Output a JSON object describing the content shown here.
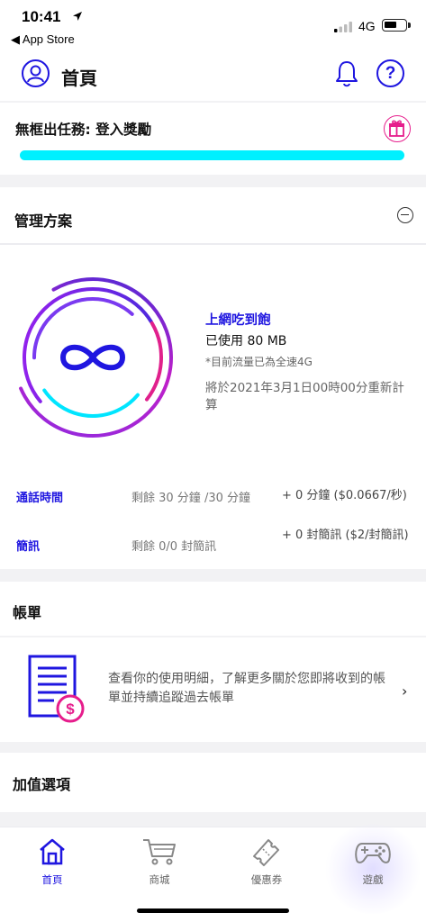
{
  "status_bar": {
    "time": "10:41",
    "back_label": "◀ App Store",
    "network": "4G"
  },
  "header": {
    "title": "首頁"
  },
  "mission": {
    "label": "無框出任務: 登入獎勵",
    "progress": 1.0
  },
  "plan": {
    "heading": "管理方案",
    "plan_name": "上網吃到飽",
    "usage": "已使用 80 MB",
    "note": "*目前流量已為全速4G",
    "reset_text": "將於2021年3月1日00時00分重新計算",
    "rows": [
      {
        "label": "通話時間",
        "remaining": "剩餘 30 分鐘 /30 分鐘",
        "extra": "+ 0 分鐘  ($0.0667/秒)"
      },
      {
        "label": "簡訊",
        "remaining": "剩餘 0/0 封簡訊",
        "extra": "+ 0 封簡訊 ($2/封簡訊)"
      }
    ]
  },
  "bill": {
    "heading": "帳單",
    "description": "查看你的使用明細，了解更多關於您即將收到的帳單並持續追蹤過去帳單"
  },
  "addons": {
    "heading": "加值選項"
  },
  "tabbar": {
    "tabs": [
      {
        "label": "首頁",
        "icon": "home-icon",
        "active": true
      },
      {
        "label": "商城",
        "icon": "cart-icon",
        "active": false
      },
      {
        "label": "優惠券",
        "icon": "coupon-icon",
        "active": false
      },
      {
        "label": "遊戲",
        "icon": "gamepad-icon",
        "active": false
      }
    ]
  },
  "colors": {
    "accent": "#1f16e0",
    "progress": "#00f0ff",
    "gift": "#e61d8c",
    "ring_gradient": [
      "#3a2bd8",
      "#8a2be2",
      "#e0208c",
      "#00e5ff"
    ]
  }
}
